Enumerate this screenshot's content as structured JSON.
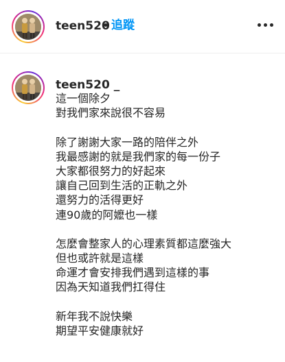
{
  "header": {
    "username": "teen520",
    "separator": "•",
    "follow_label": "追蹤",
    "more_icon": "more-horizontal-icon"
  },
  "comment": {
    "username": "teen520 _",
    "lines": [
      "這一個除夕",
      "對我們家來說很不容易",
      "",
      "除了謝謝大家一路的陪伴之外",
      "我最感謝的就是我們家的每一份子",
      "大家都很努力的好起來",
      "讓自己回到生活的正軌之外",
      "還努力的活得更好",
      "連90歲的阿嬤也一樣",
      "",
      "怎麼會整家人的心理素質都這麼強大",
      "但也或許就是這樣",
      "命運才會安排我們遇到這樣的事",
      "因為天知道我們扛得住",
      "",
      "新年我不說快樂",
      "期望平安健康就好"
    ]
  },
  "colors": {
    "text": "#262626",
    "link": "#0095f6",
    "divider": "#efefef"
  }
}
